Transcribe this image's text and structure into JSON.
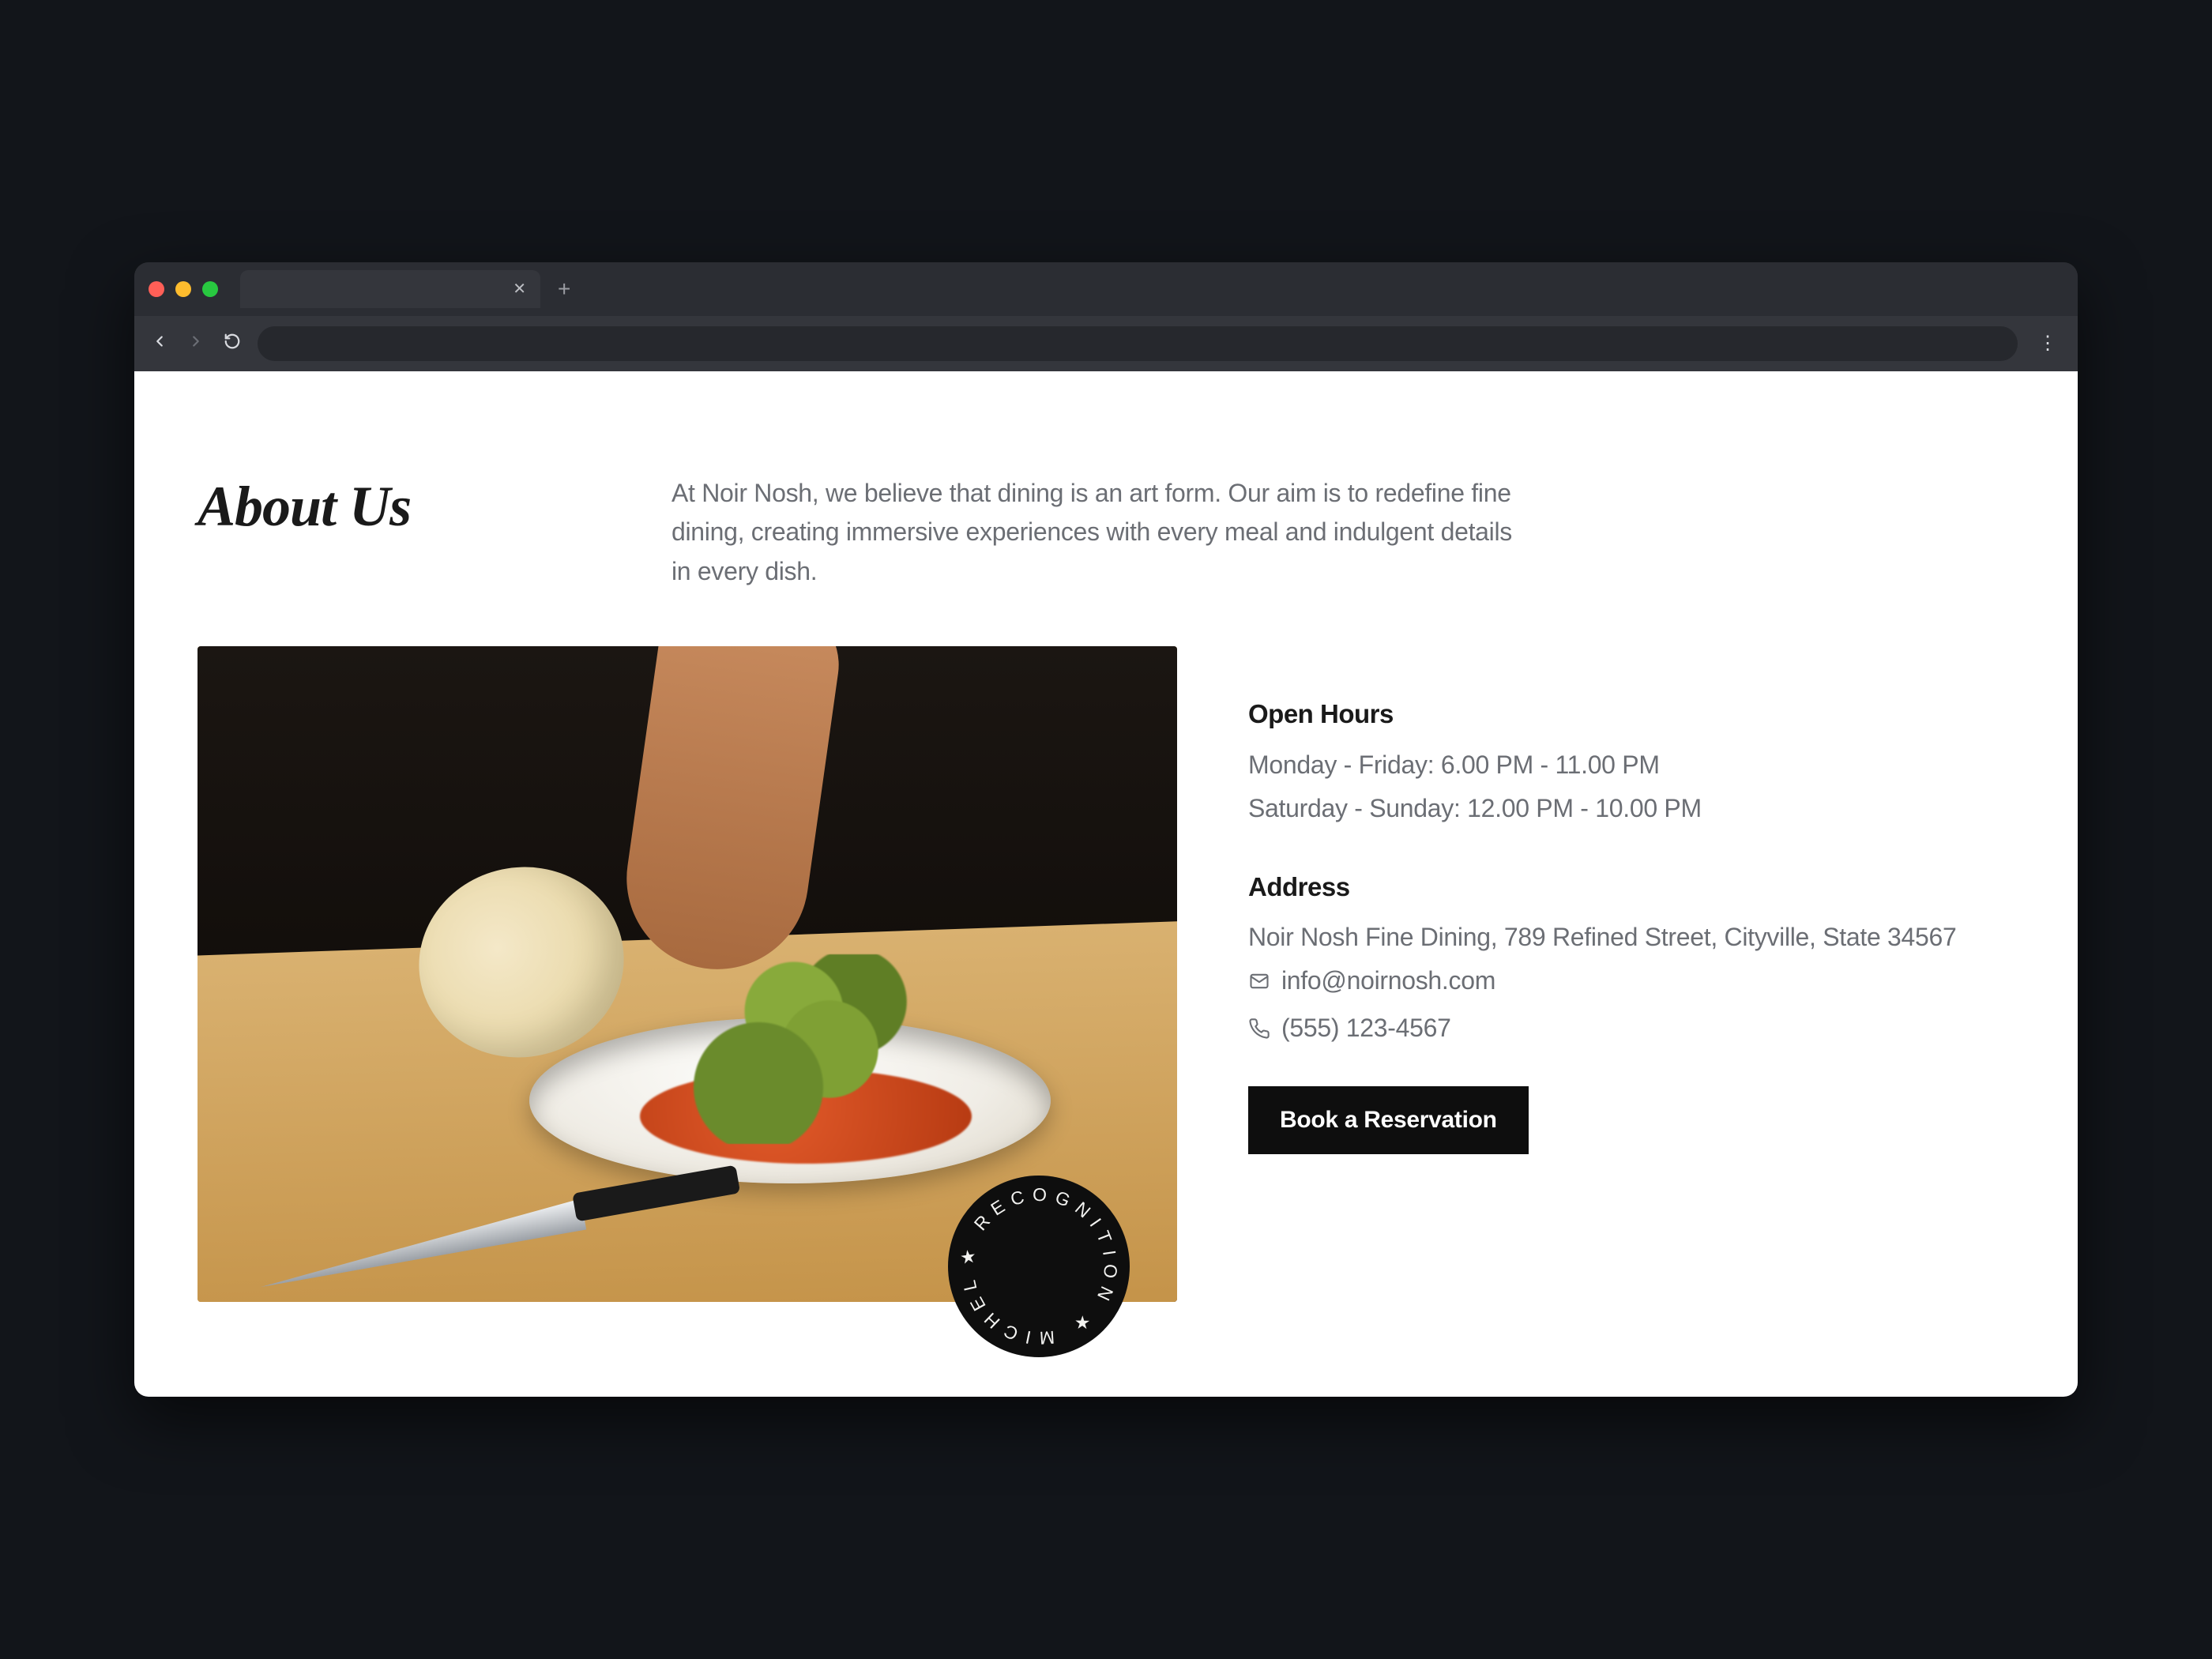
{
  "page": {
    "heading": "About Us",
    "intro": "At Noir Nosh, we believe that dining is an art form. Our aim is to redefine fine dining, creating immersive experiences with every meal and indulgent details in every dish."
  },
  "hours": {
    "heading": "Open Hours",
    "weekday": "Monday - Friday: 6.00 PM - 11.00 PM",
    "weekend": "Saturday - Sunday: 12.00 PM - 10.00 PM"
  },
  "address": {
    "heading": "Address",
    "line": "Noir Nosh Fine Dining, 789 Refined Street, Cityville, State 34567"
  },
  "contact": {
    "email": "info@noirnosh.com",
    "phone": "(555) 123-4567"
  },
  "cta": {
    "label": "Book a Reservation"
  },
  "badge": {
    "text": "★ RECOGNITION ★ MICHELIN STAR "
  },
  "chrome": {
    "omnibox_placeholder": ""
  }
}
